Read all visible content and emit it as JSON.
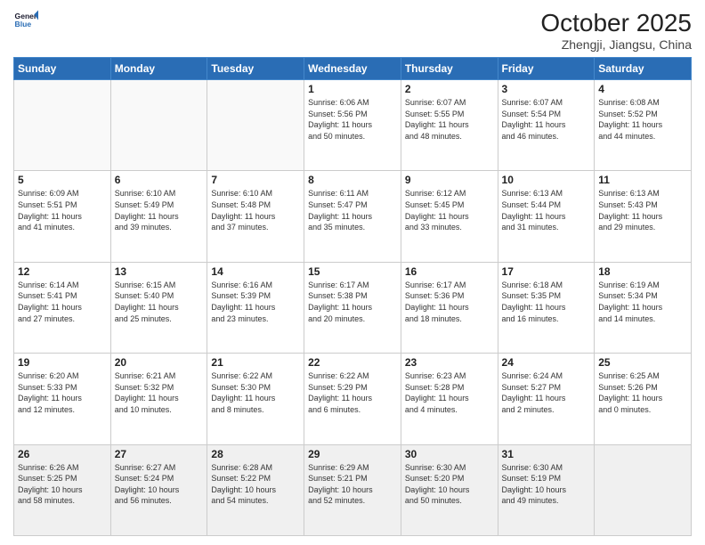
{
  "header": {
    "logo_general": "General",
    "logo_blue": "Blue",
    "month": "October 2025",
    "location": "Zhengji, Jiangsu, China"
  },
  "weekdays": [
    "Sunday",
    "Monday",
    "Tuesday",
    "Wednesday",
    "Thursday",
    "Friday",
    "Saturday"
  ],
  "weeks": [
    [
      {
        "day": "",
        "info": ""
      },
      {
        "day": "",
        "info": ""
      },
      {
        "day": "",
        "info": ""
      },
      {
        "day": "1",
        "info": "Sunrise: 6:06 AM\nSunset: 5:56 PM\nDaylight: 11 hours\nand 50 minutes."
      },
      {
        "day": "2",
        "info": "Sunrise: 6:07 AM\nSunset: 5:55 PM\nDaylight: 11 hours\nand 48 minutes."
      },
      {
        "day": "3",
        "info": "Sunrise: 6:07 AM\nSunset: 5:54 PM\nDaylight: 11 hours\nand 46 minutes."
      },
      {
        "day": "4",
        "info": "Sunrise: 6:08 AM\nSunset: 5:52 PM\nDaylight: 11 hours\nand 44 minutes."
      }
    ],
    [
      {
        "day": "5",
        "info": "Sunrise: 6:09 AM\nSunset: 5:51 PM\nDaylight: 11 hours\nand 41 minutes."
      },
      {
        "day": "6",
        "info": "Sunrise: 6:10 AM\nSunset: 5:49 PM\nDaylight: 11 hours\nand 39 minutes."
      },
      {
        "day": "7",
        "info": "Sunrise: 6:10 AM\nSunset: 5:48 PM\nDaylight: 11 hours\nand 37 minutes."
      },
      {
        "day": "8",
        "info": "Sunrise: 6:11 AM\nSunset: 5:47 PM\nDaylight: 11 hours\nand 35 minutes."
      },
      {
        "day": "9",
        "info": "Sunrise: 6:12 AM\nSunset: 5:45 PM\nDaylight: 11 hours\nand 33 minutes."
      },
      {
        "day": "10",
        "info": "Sunrise: 6:13 AM\nSunset: 5:44 PM\nDaylight: 11 hours\nand 31 minutes."
      },
      {
        "day": "11",
        "info": "Sunrise: 6:13 AM\nSunset: 5:43 PM\nDaylight: 11 hours\nand 29 minutes."
      }
    ],
    [
      {
        "day": "12",
        "info": "Sunrise: 6:14 AM\nSunset: 5:41 PM\nDaylight: 11 hours\nand 27 minutes."
      },
      {
        "day": "13",
        "info": "Sunrise: 6:15 AM\nSunset: 5:40 PM\nDaylight: 11 hours\nand 25 minutes."
      },
      {
        "day": "14",
        "info": "Sunrise: 6:16 AM\nSunset: 5:39 PM\nDaylight: 11 hours\nand 23 minutes."
      },
      {
        "day": "15",
        "info": "Sunrise: 6:17 AM\nSunset: 5:38 PM\nDaylight: 11 hours\nand 20 minutes."
      },
      {
        "day": "16",
        "info": "Sunrise: 6:17 AM\nSunset: 5:36 PM\nDaylight: 11 hours\nand 18 minutes."
      },
      {
        "day": "17",
        "info": "Sunrise: 6:18 AM\nSunset: 5:35 PM\nDaylight: 11 hours\nand 16 minutes."
      },
      {
        "day": "18",
        "info": "Sunrise: 6:19 AM\nSunset: 5:34 PM\nDaylight: 11 hours\nand 14 minutes."
      }
    ],
    [
      {
        "day": "19",
        "info": "Sunrise: 6:20 AM\nSunset: 5:33 PM\nDaylight: 11 hours\nand 12 minutes."
      },
      {
        "day": "20",
        "info": "Sunrise: 6:21 AM\nSunset: 5:32 PM\nDaylight: 11 hours\nand 10 minutes."
      },
      {
        "day": "21",
        "info": "Sunrise: 6:22 AM\nSunset: 5:30 PM\nDaylight: 11 hours\nand 8 minutes."
      },
      {
        "day": "22",
        "info": "Sunrise: 6:22 AM\nSunset: 5:29 PM\nDaylight: 11 hours\nand 6 minutes."
      },
      {
        "day": "23",
        "info": "Sunrise: 6:23 AM\nSunset: 5:28 PM\nDaylight: 11 hours\nand 4 minutes."
      },
      {
        "day": "24",
        "info": "Sunrise: 6:24 AM\nSunset: 5:27 PM\nDaylight: 11 hours\nand 2 minutes."
      },
      {
        "day": "25",
        "info": "Sunrise: 6:25 AM\nSunset: 5:26 PM\nDaylight: 11 hours\nand 0 minutes."
      }
    ],
    [
      {
        "day": "26",
        "info": "Sunrise: 6:26 AM\nSunset: 5:25 PM\nDaylight: 10 hours\nand 58 minutes."
      },
      {
        "day": "27",
        "info": "Sunrise: 6:27 AM\nSunset: 5:24 PM\nDaylight: 10 hours\nand 56 minutes."
      },
      {
        "day": "28",
        "info": "Sunrise: 6:28 AM\nSunset: 5:22 PM\nDaylight: 10 hours\nand 54 minutes."
      },
      {
        "day": "29",
        "info": "Sunrise: 6:29 AM\nSunset: 5:21 PM\nDaylight: 10 hours\nand 52 minutes."
      },
      {
        "day": "30",
        "info": "Sunrise: 6:30 AM\nSunset: 5:20 PM\nDaylight: 10 hours\nand 50 minutes."
      },
      {
        "day": "31",
        "info": "Sunrise: 6:30 AM\nSunset: 5:19 PM\nDaylight: 10 hours\nand 49 minutes."
      },
      {
        "day": "",
        "info": ""
      }
    ]
  ]
}
